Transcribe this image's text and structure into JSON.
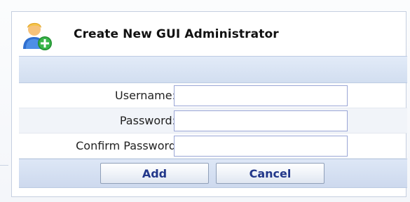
{
  "dialog": {
    "title": "Create New GUI Administrator",
    "icon": "add-user-icon"
  },
  "form": {
    "username_label": "Username:",
    "username_value": "",
    "password_label": "Password:",
    "password_value": "",
    "confirm_label": "Confirm Password",
    "confirm_value": ""
  },
  "buttons": {
    "add_label": "Add",
    "cancel_label": "Cancel"
  },
  "colors": {
    "accent_text": "#22378a",
    "header_bar": "#d2def0",
    "input_border": "#9aa6d6"
  }
}
